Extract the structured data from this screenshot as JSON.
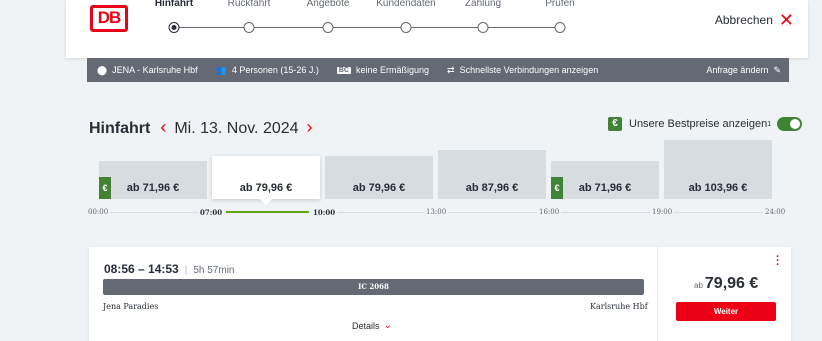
{
  "header": {
    "logo": "DB",
    "steps": [
      {
        "label": "Hinfahrt",
        "active": true
      },
      {
        "label": "Rückfahrt",
        "active": false
      },
      {
        "label": "Angebote",
        "active": false
      },
      {
        "label": "Kundendaten",
        "active": false
      },
      {
        "label": "Zahlung",
        "active": false
      },
      {
        "label": "Prüfen",
        "active": false
      }
    ],
    "cancel_label": "Abbrechen",
    "cancel_icon": "close-icon"
  },
  "infobar": {
    "route": "JENA - Karlsruhe Hbf",
    "passengers": "4 Personen (15-26 J.)",
    "discount": "keine Ermäßigung",
    "discount_badge": "BC",
    "fastest": "Schnellste Verbindungen anzeigen",
    "edit": "Anfrage ändern"
  },
  "trip": {
    "title": "Hinfahrt",
    "date": "Mi. 13. Nov. 2024",
    "prev_icon": "chevron-left-icon",
    "next_icon": "chevron-right-icon"
  },
  "bestprice": {
    "label": "Unsere Bestpreise anzeigen",
    "footnote": "1",
    "euro_symbol": "€",
    "enabled": true
  },
  "slots": [
    {
      "price": "ab 71,96 €",
      "bestprice": true,
      "selected": false,
      "level": 0.35
    },
    {
      "price": "ab 79,96 €",
      "bestprice": false,
      "selected": true,
      "level": 0.45
    },
    {
      "price": "ab 79,96 €",
      "bestprice": false,
      "selected": false,
      "level": 0.45
    },
    {
      "price": "ab 87,96 €",
      "bestprice": false,
      "selected": false,
      "level": 0.55
    },
    {
      "price": "ab 71,96 €",
      "bestprice": true,
      "selected": false,
      "level": 0.35
    },
    {
      "price": "ab 103,96 €",
      "bestprice": false,
      "selected": false,
      "level": 0.75
    }
  ],
  "timeline": {
    "ticks": [
      "00:00",
      "07:00",
      "10:00",
      "13:00",
      "16:00",
      "19:00",
      "24:00"
    ]
  },
  "connection": {
    "times": "08:56 – 14:53",
    "duration": "5h 57min",
    "train": "IC 2068",
    "from": "Jena Paradies",
    "to": "Karlsruhe Hbf",
    "details": "Details",
    "price_prefix": "ab",
    "price": "79,96 €",
    "button": "Weiter"
  },
  "colors": {
    "brand_red": "#ec0016",
    "green": "#408335",
    "timeline_green": "#63a615",
    "dark_gray": "#646973"
  }
}
